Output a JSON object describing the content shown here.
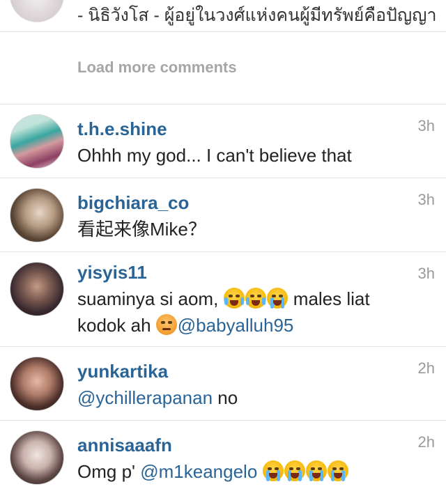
{
  "top_comment": {
    "text": "- นิธิวังโส - ผู้อยู่ในวงศ์แห่งคนผู้มีทรัพย์คือปัญญา"
  },
  "load_more": {
    "label": "Load more comments"
  },
  "comments": [
    {
      "username": "t.h.e.shine",
      "time": "3h",
      "text": "Ohhh my god... I can't believe that"
    },
    {
      "username": "bigchiara_co",
      "time": "3h",
      "text": "看起来像Mike？"
    },
    {
      "username": "yisyis11",
      "time": "3h",
      "text_part1": "suaminya si aom,",
      "text_part2": "males liat kodok ah",
      "mention": "@babyalluh95"
    },
    {
      "username": "yunkartika",
      "time": "2h",
      "mention": "@ychillerapanan",
      "text_after": "no"
    },
    {
      "username": "annisaaafn",
      "time": "2h",
      "text_before": "Omg p'",
      "mention": "@m1keangelo"
    }
  ],
  "icons": {
    "laughing_tears": "face-with-tears-of-joy",
    "loudly_crying": "loudly-crying-face",
    "persevering": "persevering-face"
  }
}
